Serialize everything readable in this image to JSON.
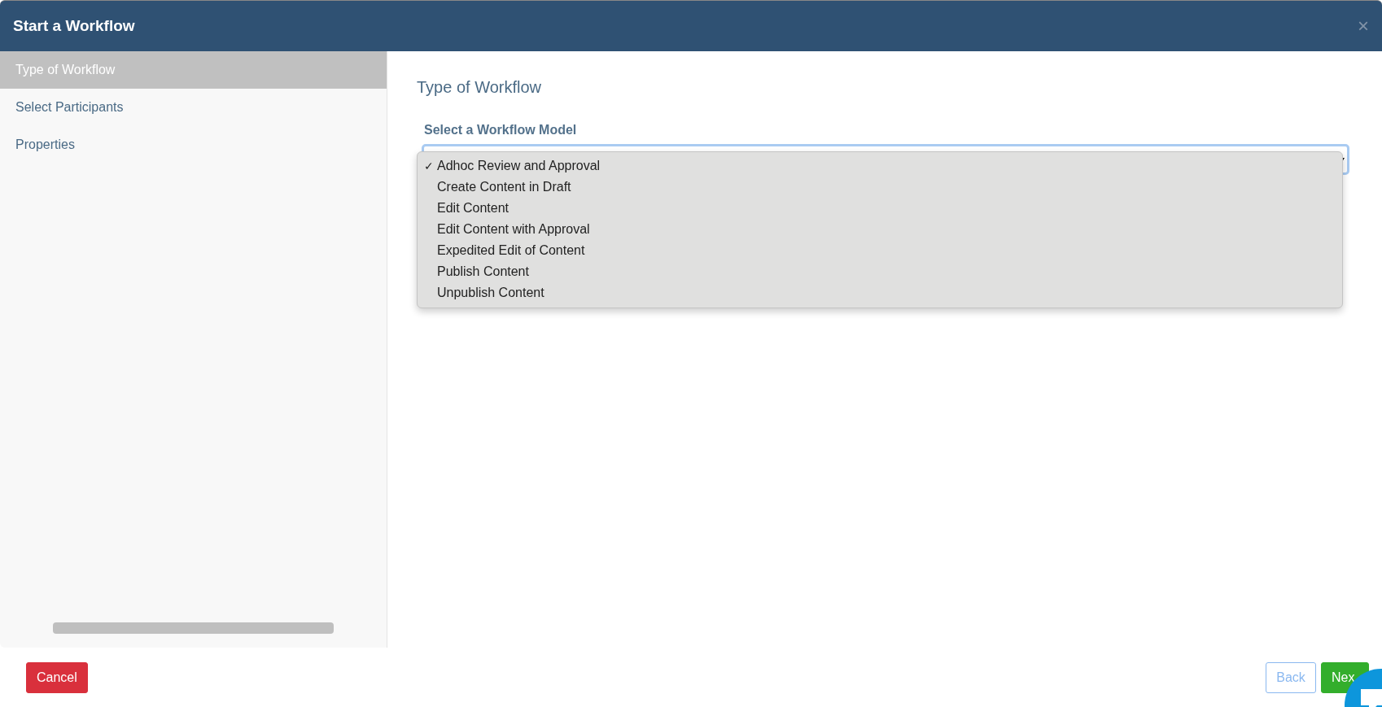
{
  "window": {
    "title": "Start a Workflow",
    "close": "×"
  },
  "sidebar": {
    "items": [
      {
        "label": "Type of Workflow",
        "selected": true
      },
      {
        "label": "Select Participants",
        "selected": false
      },
      {
        "label": "Properties",
        "selected": false
      }
    ]
  },
  "content": {
    "heading": "Type of Workflow",
    "field_label": "Select a Workflow Model",
    "dropdown": {
      "options": [
        {
          "label": "Adhoc Review and Approval",
          "selected": true
        },
        {
          "label": "Create Content in Draft",
          "selected": false
        },
        {
          "label": "Edit Content",
          "selected": false
        },
        {
          "label": "Edit Content with Approval",
          "selected": false
        },
        {
          "label": "Expedited Edit of Content",
          "selected": false
        },
        {
          "label": "Publish Content",
          "selected": false
        },
        {
          "label": "Unpublish Content",
          "selected": false
        }
      ],
      "check": "✓"
    }
  },
  "footer": {
    "cancel": "Cancel",
    "back": {
      "label": "Back",
      "disabled": true
    },
    "next": {
      "label": "Nex",
      "disabled": false
    }
  }
}
